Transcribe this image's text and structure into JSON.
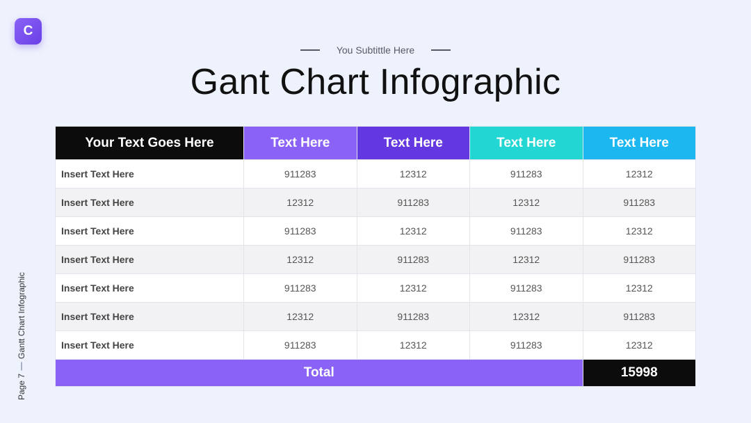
{
  "logo": {
    "letter": "C"
  },
  "subtitle": "You Subtittle Here",
  "title": "Gant Chart Infographic",
  "table": {
    "headers": [
      "Your Text Goes Here",
      "Text Here",
      "Text Here",
      "Text Here",
      "Text Here"
    ],
    "header_colors": [
      "#0c0c0c",
      "#8a63f6",
      "#6438e0",
      "#22d6d3",
      "#1cb7f0"
    ],
    "rows": [
      [
        "Insert Text Here",
        "911283",
        "12312",
        "911283",
        "12312"
      ],
      [
        "Insert Text Here",
        "12312",
        "911283",
        "12312",
        "911283"
      ],
      [
        "Insert Text Here",
        "911283",
        "12312",
        "911283",
        "12312"
      ],
      [
        "Insert Text Here",
        "12312",
        "911283",
        "12312",
        "911283"
      ],
      [
        "Insert Text Here",
        "911283",
        "12312",
        "911283",
        "12312"
      ],
      [
        "Insert Text Here",
        "12312",
        "911283",
        "12312",
        "911283"
      ],
      [
        "Insert Text Here",
        "911283",
        "12312",
        "911283",
        "12312"
      ]
    ],
    "total_label": "Total",
    "total_value": "15998"
  },
  "footer": {
    "page": "Page 7",
    "section": "Gantt Chart Infographic"
  }
}
